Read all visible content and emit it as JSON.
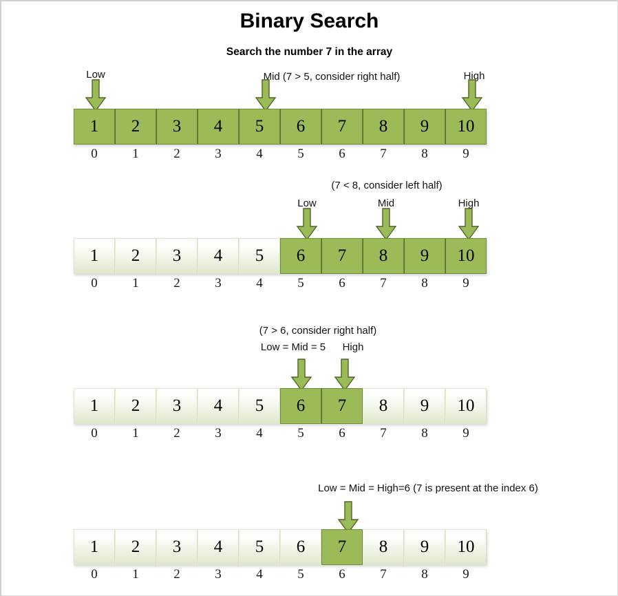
{
  "header": {
    "title": "Binary Search",
    "subtitle": "Search the number 7 in the array"
  },
  "colors": {
    "active_fill": "#9BBB59",
    "active_border": "#6F8A38",
    "inactive_fill_top": "#FFFFFF",
    "inactive_fill_bottom": "#DFE8CC",
    "arrow_fill": "#9BBB59",
    "arrow_border": "#4F6228",
    "text": "#000000",
    "frame_border": "#D9D9D9"
  },
  "array": {
    "values": [
      "1",
      "2",
      "3",
      "4",
      "5",
      "6",
      "7",
      "8",
      "9",
      "10"
    ],
    "indices": [
      "0",
      "1",
      "2",
      "3",
      "4",
      "5",
      "6",
      "7",
      "8",
      "9"
    ]
  },
  "steps": [
    {
      "id": "step-1",
      "active_range": [
        0,
        9
      ],
      "notes": [],
      "pointers": [
        {
          "name": "low",
          "label": "Low",
          "index": 0
        },
        {
          "name": "mid",
          "label": "Mid (7 > 5, consider right half)",
          "index": 4
        },
        {
          "name": "high",
          "label": "High",
          "index": 9
        }
      ]
    },
    {
      "id": "step-2",
      "active_range": [
        5,
        9
      ],
      "notes": [
        {
          "name": "comparison-note",
          "text": "(7 < 8, consider left half)",
          "index": 7
        }
      ],
      "pointers": [
        {
          "name": "low",
          "label": "Low",
          "index": 5
        },
        {
          "name": "mid",
          "label": "Mid",
          "index": 7
        },
        {
          "name": "high",
          "label": "High",
          "index": 9
        }
      ]
    },
    {
      "id": "step-3",
      "active_range": [
        5,
        6
      ],
      "notes": [
        {
          "name": "comparison-note",
          "text": "(7 > 6, consider right half)",
          "index": 5.5
        }
      ],
      "pointers": [
        {
          "name": "low-mid",
          "label": "Low = Mid = 5",
          "index": 5
        },
        {
          "name": "high",
          "label": "High",
          "index": 6
        }
      ]
    },
    {
      "id": "step-4",
      "active_range": [
        6,
        6
      ],
      "notes": [],
      "pointers": [
        {
          "name": "result",
          "label": "Low = Mid = High=6 (7 is present at the index 6)",
          "index": 6
        }
      ]
    }
  ]
}
